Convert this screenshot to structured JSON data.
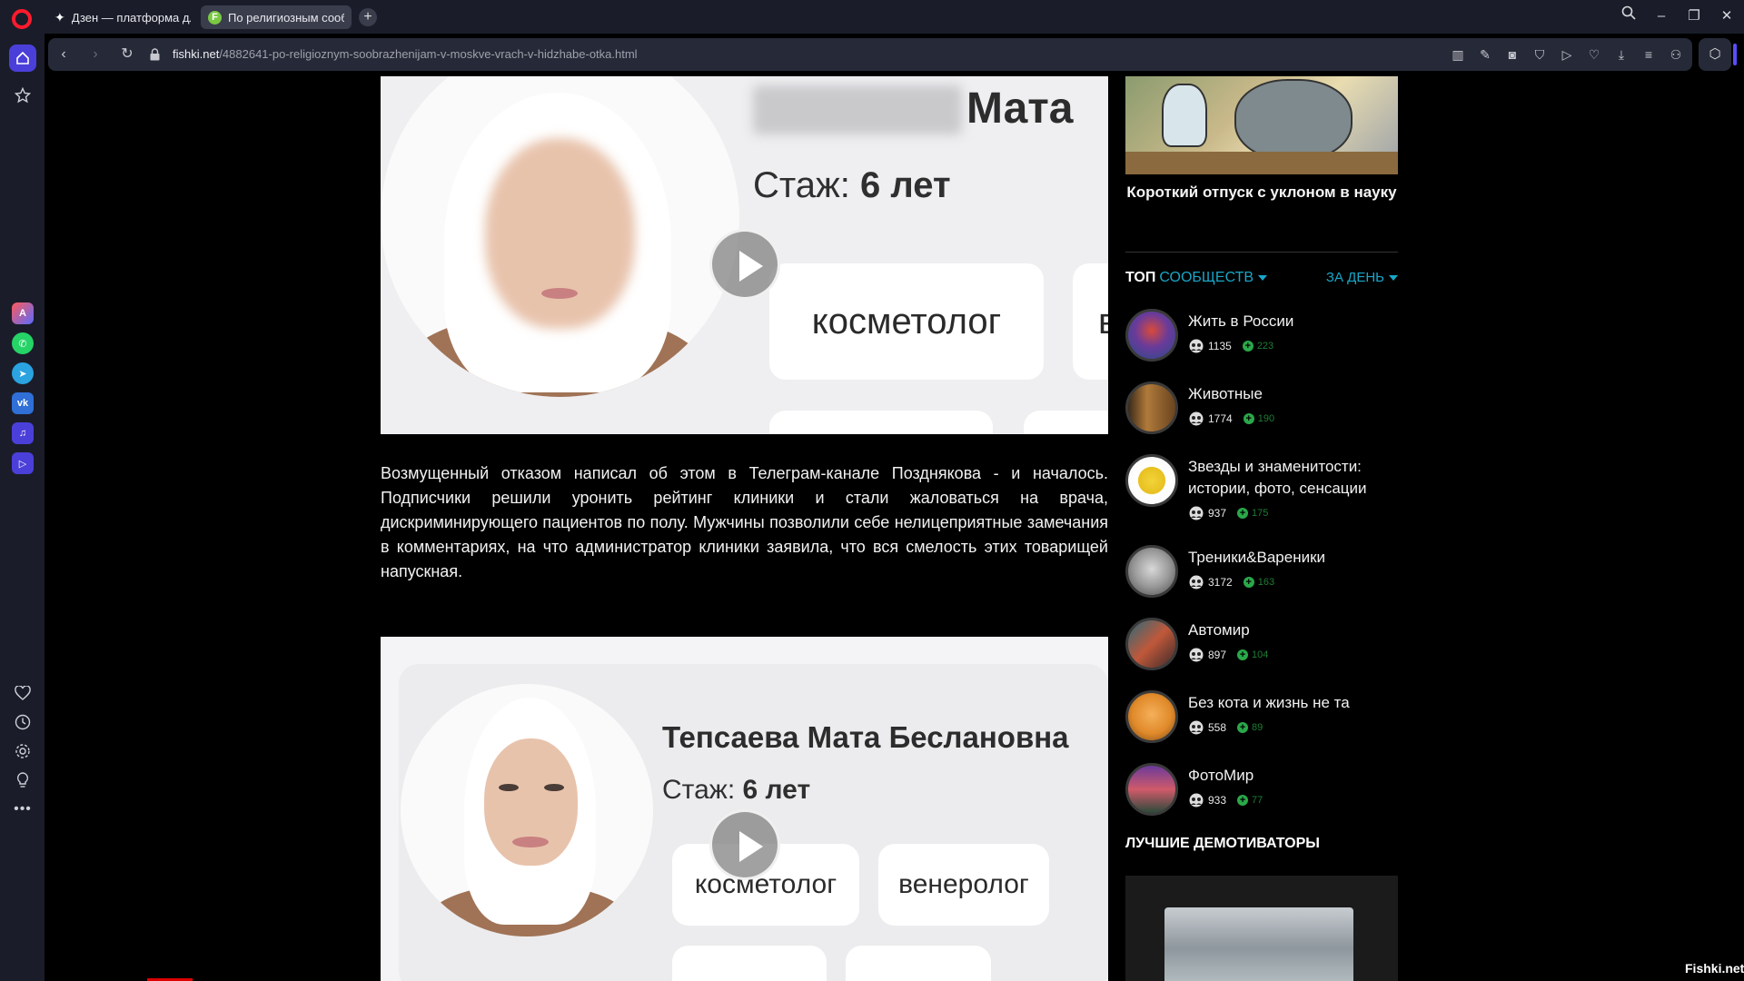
{
  "browser": {
    "tabs": [
      {
        "label": "Дзен — платформа для п"
      },
      {
        "label": "По религиозным сообра"
      }
    ],
    "new_tab": "+",
    "window_controls": {
      "minimize": "–",
      "restore": "❐",
      "close": "✕"
    },
    "address": {
      "host": "fishki.net",
      "path": "/4882641-po-religioznym-soobrazhenijam-v-moskve-vrach-v-hidzhabe-otka.html"
    }
  },
  "video1": {
    "name_visible": "Мата",
    "stazh_label": "Стаж:",
    "stazh_value": "6 лет",
    "chip1": "косметолог",
    "chip2": "в"
  },
  "article": {
    "paragraph": "Возмущенный отказом написал об этом в Телеграм-канале Позднякова - и началось. Подписчики решили уронить рейтинг клиники и стали жаловаться на врача, дискриминирующего пациентов по полу. Мужчины позволили себе нелицеприятные замечания в комментариях, на что администратор клиники заявила, что вся смелость этих товарищей напускная."
  },
  "video2": {
    "name": "Тепсаева Мата Беслановна",
    "stazh_label": "Стаж:",
    "stazh_value": "6 лет",
    "chip1": "косметолог",
    "chip2": "венеролог"
  },
  "sidebar_right": {
    "promo_caption": "Короткий отпуск с уклоном в науку",
    "top_title": "ТОП",
    "top_filter": "СООБЩЕСТВ",
    "period": "ЗА ДЕНЬ",
    "communities": [
      {
        "name": "Жить в России",
        "members": "1135",
        "growth": "223"
      },
      {
        "name": "Животные",
        "members": "1774",
        "growth": "190"
      },
      {
        "name": "Звезды и знаменитости: истории, фото, сенсации",
        "members": "937",
        "growth": "175"
      },
      {
        "name": "Треники&Вареники",
        "members": "3172",
        "growth": "163"
      },
      {
        "name": "Автомир",
        "members": "897",
        "growth": "104"
      },
      {
        "name": "Без кота и жизнь не та",
        "members": "558",
        "growth": "89"
      },
      {
        "name": "ФотоМир",
        "members": "933",
        "growth": "77"
      }
    ],
    "demot_title": "ЛУЧШИЕ ДЕМОТИВАТОРЫ"
  },
  "watermark": "Fishki.net",
  "colors": {
    "accent": "#1aa6c8",
    "growth": "#2aa84a",
    "opera_red": "#ff1b2d",
    "sidebar_active": "#4b3fd9"
  }
}
